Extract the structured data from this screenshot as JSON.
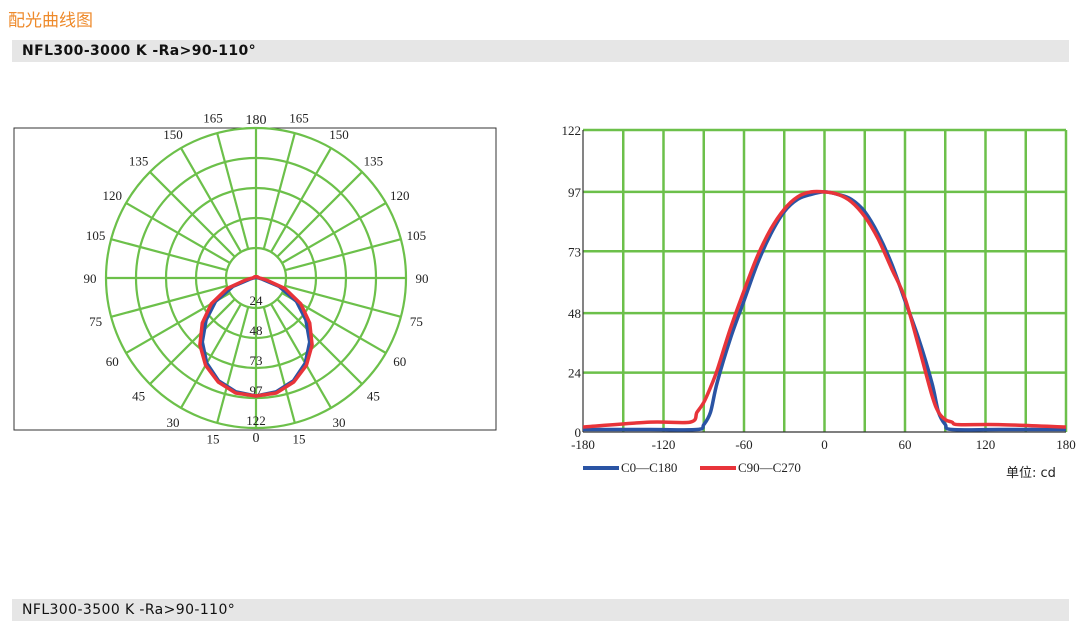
{
  "page": {
    "title": "配光曲线图",
    "section1": "NFL300-3000 K -Ra>90-110°",
    "section2": "NFL300-3500 K -Ra>90-110°",
    "unit_label": "单位: cd"
  },
  "colors": {
    "grid": "#6cc04a",
    "c0": "#2a54a4",
    "c90": "#e8343a"
  },
  "chart_data": [
    {
      "type": "polar",
      "radial_ticks": [
        "24",
        "48",
        "73",
        "97",
        "122"
      ],
      "radial_max": 122,
      "angle_labels_left": [
        "165",
        "150",
        "135",
        "120",
        "105",
        "90",
        "75",
        "60",
        "45",
        "30",
        "15"
      ],
      "angle_labels_right": [
        "165",
        "150",
        "135",
        "120",
        "105",
        "90",
        "75",
        "60",
        "45",
        "30",
        "15"
      ],
      "top_label": "180",
      "bottom_label": "0",
      "series": [
        {
          "name": "C0-C180",
          "angles": [
            0,
            10,
            20,
            30,
            40,
            50,
            60,
            70,
            80,
            90,
            100,
            130,
            180
          ],
          "values": [
            96,
            94,
            89,
            80,
            68,
            53,
            38,
            20,
            5,
            2,
            1,
            1,
            0.5
          ]
        },
        {
          "name": "C90-C270",
          "angles": [
            0,
            10,
            20,
            30,
            40,
            50,
            60,
            70,
            80,
            90,
            100,
            130,
            180
          ],
          "values": [
            96,
            95,
            90,
            82,
            71,
            57,
            42,
            25,
            8,
            3,
            2,
            1.5,
            1
          ]
        }
      ]
    },
    {
      "type": "line",
      "x_ticks": [
        "-180",
        "-120",
        "-60",
        "0",
        "60",
        "120",
        "180"
      ],
      "y_ticks": [
        "0",
        "24",
        "48",
        "73",
        "97",
        "122"
      ],
      "xlim": [
        -180,
        180
      ],
      "ylim": [
        0,
        122
      ],
      "series": [
        {
          "name": "C0-C180",
          "x": [
            -180,
            -130,
            -95,
            -90,
            -85,
            -80,
            -70,
            -60,
            -50,
            -40,
            -30,
            -20,
            -10,
            0,
            10,
            20,
            30,
            40,
            50,
            60,
            70,
            80,
            85,
            90,
            95,
            130,
            180
          ],
          "y": [
            1,
            1,
            1,
            3,
            8,
            20,
            38,
            53,
            68,
            80,
            89,
            94,
            96,
            97,
            96,
            94,
            89,
            80,
            68,
            53,
            38,
            20,
            8,
            3,
            1,
            1,
            1
          ]
        },
        {
          "name": "C90-C270",
          "x": [
            -180,
            -130,
            -100,
            -95,
            -90,
            -85,
            -80,
            -70,
            -60,
            -50,
            -40,
            -30,
            -20,
            -10,
            0,
            10,
            20,
            30,
            40,
            50,
            60,
            70,
            80,
            85,
            90,
            95,
            100,
            130,
            180
          ],
          "y": [
            2,
            4,
            4,
            8,
            12,
            18,
            25,
            42,
            57,
            71,
            82,
            90,
            95,
            97,
            97,
            96,
            93,
            87,
            78,
            66,
            54,
            35,
            15,
            8,
            5,
            4,
            3,
            3,
            2
          ]
        }
      ]
    }
  ],
  "legend": [
    {
      "label": "C0—C180",
      "color": "#2a54a4"
    },
    {
      "label": "C90—C270",
      "color": "#e8343a"
    }
  ]
}
